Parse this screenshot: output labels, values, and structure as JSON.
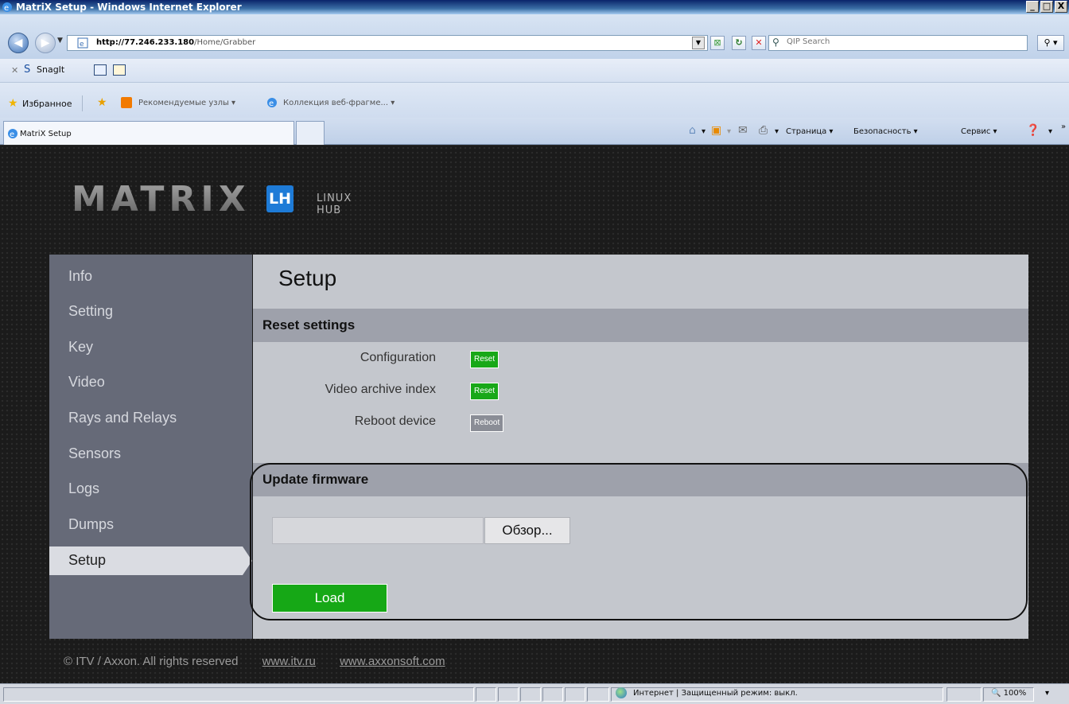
{
  "window": {
    "title": "MatriX Setup - Windows Internet Explorer",
    "controls": [
      "_",
      "□",
      "X"
    ]
  },
  "address": {
    "url_host": "http://77.246.233.180",
    "url_path": "/Home/Grabber",
    "search_placeholder": "QIP Search"
  },
  "snagit": {
    "label": "SnagIt"
  },
  "favorites": {
    "label": "Избранное",
    "items": [
      "Рекомендуемые узлы ▾",
      "Коллекция веб-фрагме... ▾"
    ]
  },
  "tabs": {
    "active": "MatriX Setup"
  },
  "commandbar": {
    "page": "Страница ▾",
    "safety": "Безопасность ▾",
    "tools": "Сервис ▾",
    "more": "»"
  },
  "site": {
    "logo_word": "MATRIX",
    "logo_badge": "LH",
    "logo_sub": "LINUX HUB",
    "nav": [
      "Info",
      "Setting",
      "Key",
      "Video",
      "Rays and Relays",
      "Sensors",
      "Logs",
      "Dumps",
      "Setup"
    ],
    "active_nav": "Setup",
    "content_title": "Setup",
    "reset_section": {
      "title": "Reset settings",
      "rows": [
        {
          "label": "Configuration",
          "button": "Reset"
        },
        {
          "label": "Video archive index",
          "button": "Reset"
        },
        {
          "label": "Reboot device",
          "button": "Reboot"
        }
      ]
    },
    "firmware_section": {
      "title": "Update firmware",
      "browse_label": "Обзор...",
      "file_value": "",
      "load_label": "Load"
    },
    "footer": {
      "copyright": "© ITV / Axxon. All rights reserved",
      "links": [
        "www.itv.ru",
        "www.axxonsoft.com"
      ]
    }
  },
  "status": {
    "zone": "Интернет | Защищенный режим: выкл.",
    "zoom": "100%"
  },
  "colors": {
    "accent_green": "#18a818",
    "logo_blue": "#1e7bd7",
    "sidebar_bg": "#666a78",
    "content_bg": "#c4c7cd"
  }
}
